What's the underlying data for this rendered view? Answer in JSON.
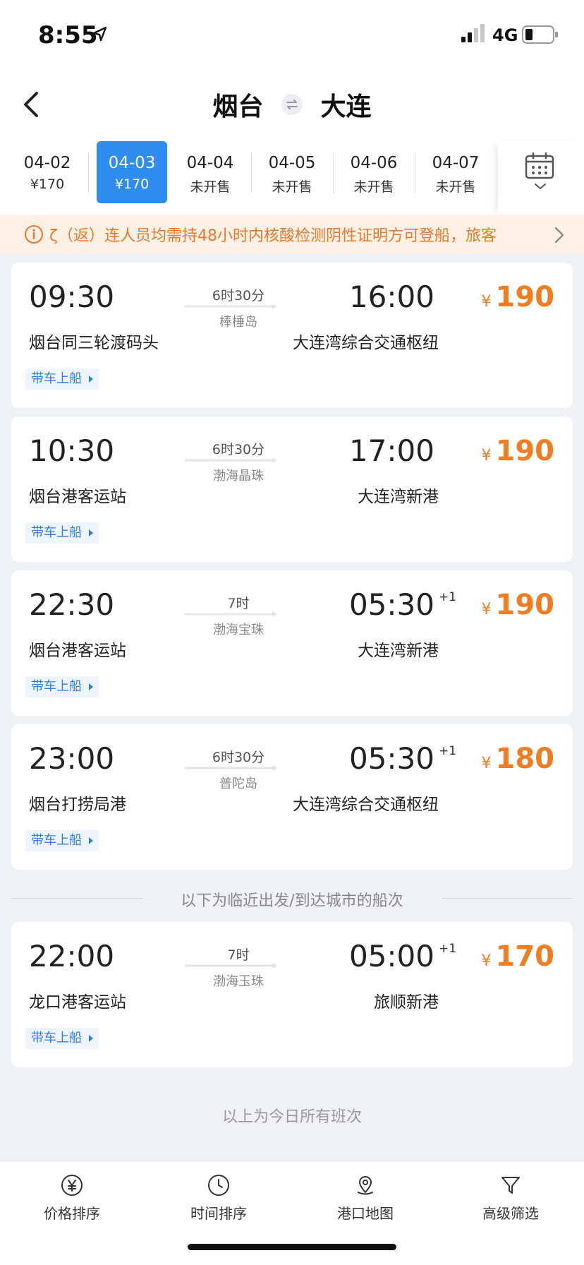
{
  "status_bar": {
    "time": "8:55",
    "network": "4G"
  },
  "header": {
    "from_city": "烟台",
    "to_city": "大连"
  },
  "dates": [
    {
      "date": "04-02",
      "status": "¥170",
      "active": false
    },
    {
      "date": "04-03",
      "status": "¥170",
      "active": true
    },
    {
      "date": "04-04",
      "status": "未开售",
      "active": false
    },
    {
      "date": "04-05",
      "status": "未开售",
      "active": false
    },
    {
      "date": "04-06",
      "status": "未开售",
      "active": false
    },
    {
      "date": "04-07",
      "status": "未开售",
      "active": false
    }
  ],
  "notice": {
    "text": "ζ（返）连人员均需持48小时内核酸检测阴性证明方可登船，旅客"
  },
  "colors": {
    "accent": "#2f8cf0",
    "price": "#f07d22",
    "notice_bg": "#fdf1e6"
  },
  "trips": [
    {
      "depart_time": "09:30",
      "arrive_time": "16:00",
      "next_day": "",
      "duration": "6时30分",
      "ship": "棒棰岛",
      "depart_port": "烟台同三轮渡码头",
      "arrive_port": "大连湾综合交通枢纽",
      "currency": "¥",
      "price": "190",
      "tag": "带车上船"
    },
    {
      "depart_time": "10:30",
      "arrive_time": "17:00",
      "next_day": "",
      "duration": "6时30分",
      "ship": "渤海晶珠",
      "depart_port": "烟台港客运站",
      "arrive_port": "大连湾新港",
      "currency": "¥",
      "price": "190",
      "tag": "带车上船"
    },
    {
      "depart_time": "22:30",
      "arrive_time": "05:30",
      "next_day": "+1",
      "duration": "7时",
      "ship": "渤海宝珠",
      "depart_port": "烟台港客运站",
      "arrive_port": "大连湾新港",
      "currency": "¥",
      "price": "190",
      "tag": "带车上船"
    },
    {
      "depart_time": "23:00",
      "arrive_time": "05:30",
      "next_day": "+1",
      "duration": "6时30分",
      "ship": "普陀岛",
      "depart_port": "烟台打捞局港",
      "arrive_port": "大连湾综合交通枢纽",
      "currency": "¥",
      "price": "180",
      "tag": "带车上船"
    }
  ],
  "nearby_divider": "以下为临近出发/到达城市的船次",
  "nearby_trips": [
    {
      "depart_time": "22:00",
      "arrive_time": "05:00",
      "next_day": "+1",
      "duration": "7时",
      "ship": "渤海玉珠",
      "depart_port": "龙口港客运站",
      "arrive_port": "旅顺新港",
      "currency": "¥",
      "price": "170",
      "tag": "带车上船"
    }
  ],
  "end_text": "以上为今日所有班次",
  "bottom_bar": [
    {
      "label": "价格排序",
      "icon": "yuan-icon"
    },
    {
      "label": "时间排序",
      "icon": "clock-icon"
    },
    {
      "label": "港口地图",
      "icon": "map-pin-icon"
    },
    {
      "label": "高级筛选",
      "icon": "filter-icon"
    }
  ]
}
